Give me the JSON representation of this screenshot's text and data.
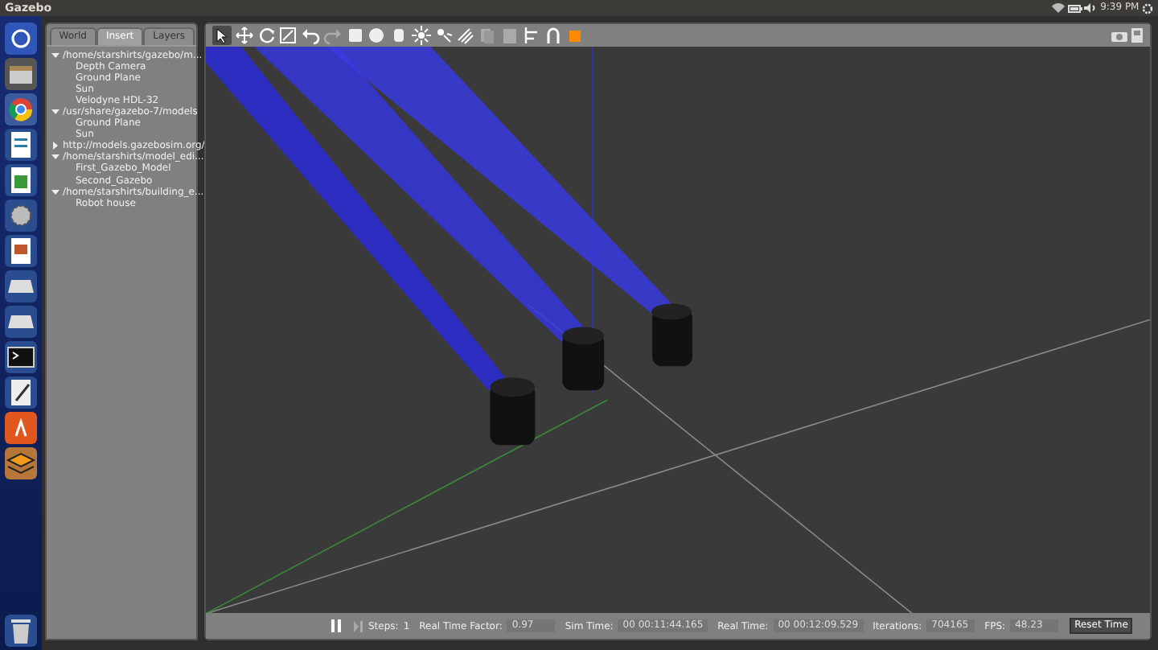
{
  "top_panel": {
    "title": "Gazebo",
    "clock": "9:39 PM"
  },
  "left_panel": {
    "tabs": [
      {
        "label": "World",
        "selected": false
      },
      {
        "label": "Insert",
        "selected": true
      },
      {
        "label": "Layers",
        "selected": false
      }
    ],
    "tree": [
      {
        "label": "/home/starshirts/gazebo/m...",
        "expanded": true,
        "children": [
          {
            "label": "Depth Camera"
          },
          {
            "label": "Ground Plane"
          },
          {
            "label": "Sun"
          },
          {
            "label": "Velodyne HDL-32"
          }
        ]
      },
      {
        "label": "/usr/share/gazebo-7/models",
        "expanded": true,
        "children": [
          {
            "label": "Ground Plane"
          },
          {
            "label": "Sun"
          }
        ]
      },
      {
        "label": "http://models.gazebosim.org/",
        "expanded": false
      },
      {
        "label": "/home/starshirts/model_edi...",
        "expanded": true,
        "children": [
          {
            "label": "First_Gazebo_Model"
          },
          {
            "label": "Second_Gazebo"
          }
        ]
      },
      {
        "label": "/home/starshirts/building_e...",
        "expanded": true,
        "children": [
          {
            "label": "Robot house"
          }
        ]
      }
    ]
  },
  "toolbar": {
    "tools": [
      {
        "kind": "select",
        "selected": true
      },
      {
        "kind": "translate",
        "selected": false
      },
      {
        "kind": "rotate",
        "selected": false
      },
      {
        "kind": "scale",
        "selected": false
      }
    ]
  },
  "bottom_bar": {
    "steps_label": "Steps:",
    "steps_value": "1",
    "fields": [
      {
        "label": "Real Time Factor:",
        "value": "0.97"
      },
      {
        "label": "Sim Time:",
        "value": "00 00:11:44.165"
      },
      {
        "label": "Real Time:",
        "value": "00 00:12:09.529"
      },
      {
        "label": "Iterations:",
        "value": "704165"
      },
      {
        "label": "FPS:",
        "value": "48.23"
      }
    ],
    "reset_button": "Reset Time"
  }
}
